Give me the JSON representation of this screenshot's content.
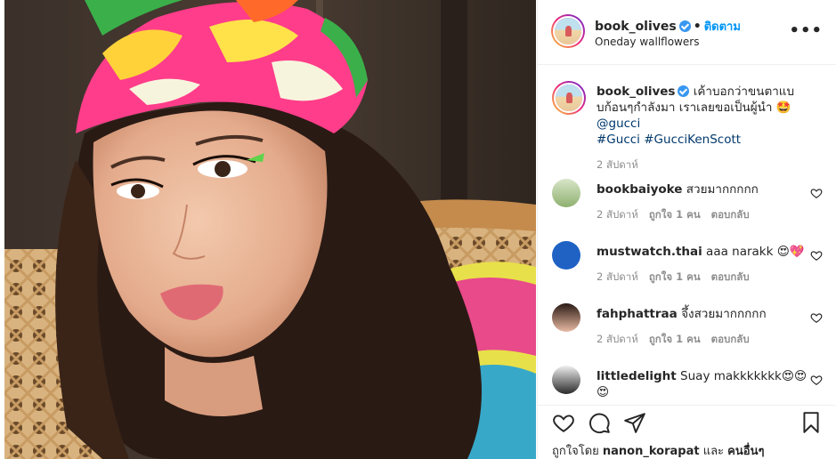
{
  "post": {
    "photo_icon": "portrait-photo",
    "author": {
      "username": "book_olives",
      "verified": true,
      "follow_label": "ติดตาม",
      "subtitle": "Oneday wallflowers"
    },
    "more_icon": "more-options-icon",
    "caption": {
      "username": "book_olives",
      "text_line": "เค้าบอกว่าขนตาแบบก้อนๆกำลังมา เราเลยขอเป็นผู้นำ 🤩",
      "mention": "@gucci",
      "hashtag1": "#Gucci",
      "hashtag2": "#GucciKenScott",
      "time": "2 สัปดาห์"
    },
    "comments": [
      {
        "username": "bookbaiyoke",
        "text": "สวยมากกกกก",
        "time": "2 สัปดาห์",
        "likes": "ถูกใจ 1 คน",
        "reply": "ตอบกลับ"
      },
      {
        "username": "mustwatch.thai",
        "text": "aaa narakk 😍💖",
        "time": "2 สัปดาห์",
        "likes": "ถูกใจ 1 คน",
        "reply": "ตอบกลับ"
      },
      {
        "username": "fahphattraa",
        "text": "จึ้งสวยมากกกกก",
        "time": "2 สัปดาห์",
        "likes": "ถูกใจ 1 คน",
        "reply": "ตอบกลับ"
      },
      {
        "username": "littledelight",
        "text": "Suay makkkkkkk😍😍😍"
      }
    ],
    "likes": {
      "prefix": "ถูกใจโดย",
      "user": "nanon_korapat",
      "conj": "และ",
      "others": "คนอื่นๆ"
    },
    "colors": {
      "accent": "#0095f6",
      "verified": "#3897f0",
      "muted": "#8e8e8e",
      "tag": "#00376b"
    }
  }
}
